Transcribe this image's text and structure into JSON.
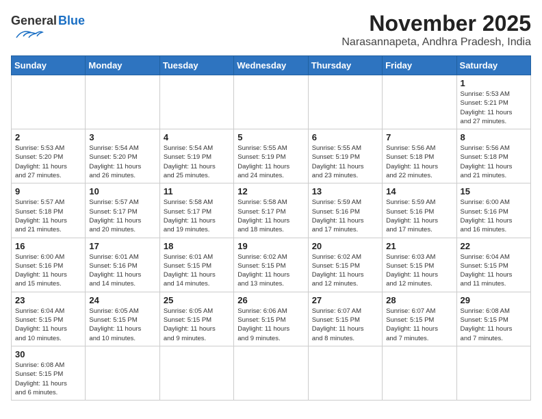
{
  "header": {
    "logo_general": "General",
    "logo_blue": "Blue",
    "month_title": "November 2025",
    "location": "Narasannapeta, Andhra Pradesh, India"
  },
  "weekdays": [
    "Sunday",
    "Monday",
    "Tuesday",
    "Wednesday",
    "Thursday",
    "Friday",
    "Saturday"
  ],
  "weeks": [
    [
      {
        "day": "",
        "info": ""
      },
      {
        "day": "",
        "info": ""
      },
      {
        "day": "",
        "info": ""
      },
      {
        "day": "",
        "info": ""
      },
      {
        "day": "",
        "info": ""
      },
      {
        "day": "",
        "info": ""
      },
      {
        "day": "1",
        "info": "Sunrise: 5:53 AM\nSunset: 5:21 PM\nDaylight: 11 hours\nand 27 minutes."
      }
    ],
    [
      {
        "day": "2",
        "info": "Sunrise: 5:53 AM\nSunset: 5:20 PM\nDaylight: 11 hours\nand 27 minutes."
      },
      {
        "day": "3",
        "info": "Sunrise: 5:54 AM\nSunset: 5:20 PM\nDaylight: 11 hours\nand 26 minutes."
      },
      {
        "day": "4",
        "info": "Sunrise: 5:54 AM\nSunset: 5:19 PM\nDaylight: 11 hours\nand 25 minutes."
      },
      {
        "day": "5",
        "info": "Sunrise: 5:55 AM\nSunset: 5:19 PM\nDaylight: 11 hours\nand 24 minutes."
      },
      {
        "day": "6",
        "info": "Sunrise: 5:55 AM\nSunset: 5:19 PM\nDaylight: 11 hours\nand 23 minutes."
      },
      {
        "day": "7",
        "info": "Sunrise: 5:56 AM\nSunset: 5:18 PM\nDaylight: 11 hours\nand 22 minutes."
      },
      {
        "day": "8",
        "info": "Sunrise: 5:56 AM\nSunset: 5:18 PM\nDaylight: 11 hours\nand 21 minutes."
      }
    ],
    [
      {
        "day": "9",
        "info": "Sunrise: 5:57 AM\nSunset: 5:18 PM\nDaylight: 11 hours\nand 21 minutes."
      },
      {
        "day": "10",
        "info": "Sunrise: 5:57 AM\nSunset: 5:17 PM\nDaylight: 11 hours\nand 20 minutes."
      },
      {
        "day": "11",
        "info": "Sunrise: 5:58 AM\nSunset: 5:17 PM\nDaylight: 11 hours\nand 19 minutes."
      },
      {
        "day": "12",
        "info": "Sunrise: 5:58 AM\nSunset: 5:17 PM\nDaylight: 11 hours\nand 18 minutes."
      },
      {
        "day": "13",
        "info": "Sunrise: 5:59 AM\nSunset: 5:16 PM\nDaylight: 11 hours\nand 17 minutes."
      },
      {
        "day": "14",
        "info": "Sunrise: 5:59 AM\nSunset: 5:16 PM\nDaylight: 11 hours\nand 17 minutes."
      },
      {
        "day": "15",
        "info": "Sunrise: 6:00 AM\nSunset: 5:16 PM\nDaylight: 11 hours\nand 16 minutes."
      }
    ],
    [
      {
        "day": "16",
        "info": "Sunrise: 6:00 AM\nSunset: 5:16 PM\nDaylight: 11 hours\nand 15 minutes."
      },
      {
        "day": "17",
        "info": "Sunrise: 6:01 AM\nSunset: 5:16 PM\nDaylight: 11 hours\nand 14 minutes."
      },
      {
        "day": "18",
        "info": "Sunrise: 6:01 AM\nSunset: 5:15 PM\nDaylight: 11 hours\nand 14 minutes."
      },
      {
        "day": "19",
        "info": "Sunrise: 6:02 AM\nSunset: 5:15 PM\nDaylight: 11 hours\nand 13 minutes."
      },
      {
        "day": "20",
        "info": "Sunrise: 6:02 AM\nSunset: 5:15 PM\nDaylight: 11 hours\nand 12 minutes."
      },
      {
        "day": "21",
        "info": "Sunrise: 6:03 AM\nSunset: 5:15 PM\nDaylight: 11 hours\nand 12 minutes."
      },
      {
        "day": "22",
        "info": "Sunrise: 6:04 AM\nSunset: 5:15 PM\nDaylight: 11 hours\nand 11 minutes."
      }
    ],
    [
      {
        "day": "23",
        "info": "Sunrise: 6:04 AM\nSunset: 5:15 PM\nDaylight: 11 hours\nand 10 minutes."
      },
      {
        "day": "24",
        "info": "Sunrise: 6:05 AM\nSunset: 5:15 PM\nDaylight: 11 hours\nand 10 minutes."
      },
      {
        "day": "25",
        "info": "Sunrise: 6:05 AM\nSunset: 5:15 PM\nDaylight: 11 hours\nand 9 minutes."
      },
      {
        "day": "26",
        "info": "Sunrise: 6:06 AM\nSunset: 5:15 PM\nDaylight: 11 hours\nand 9 minutes."
      },
      {
        "day": "27",
        "info": "Sunrise: 6:07 AM\nSunset: 5:15 PM\nDaylight: 11 hours\nand 8 minutes."
      },
      {
        "day": "28",
        "info": "Sunrise: 6:07 AM\nSunset: 5:15 PM\nDaylight: 11 hours\nand 7 minutes."
      },
      {
        "day": "29",
        "info": "Sunrise: 6:08 AM\nSunset: 5:15 PM\nDaylight: 11 hours\nand 7 minutes."
      }
    ],
    [
      {
        "day": "30",
        "info": "Sunrise: 6:08 AM\nSunset: 5:15 PM\nDaylight: 11 hours\nand 6 minutes."
      },
      {
        "day": "",
        "info": ""
      },
      {
        "day": "",
        "info": ""
      },
      {
        "day": "",
        "info": ""
      },
      {
        "day": "",
        "info": ""
      },
      {
        "day": "",
        "info": ""
      },
      {
        "day": "",
        "info": ""
      }
    ]
  ]
}
